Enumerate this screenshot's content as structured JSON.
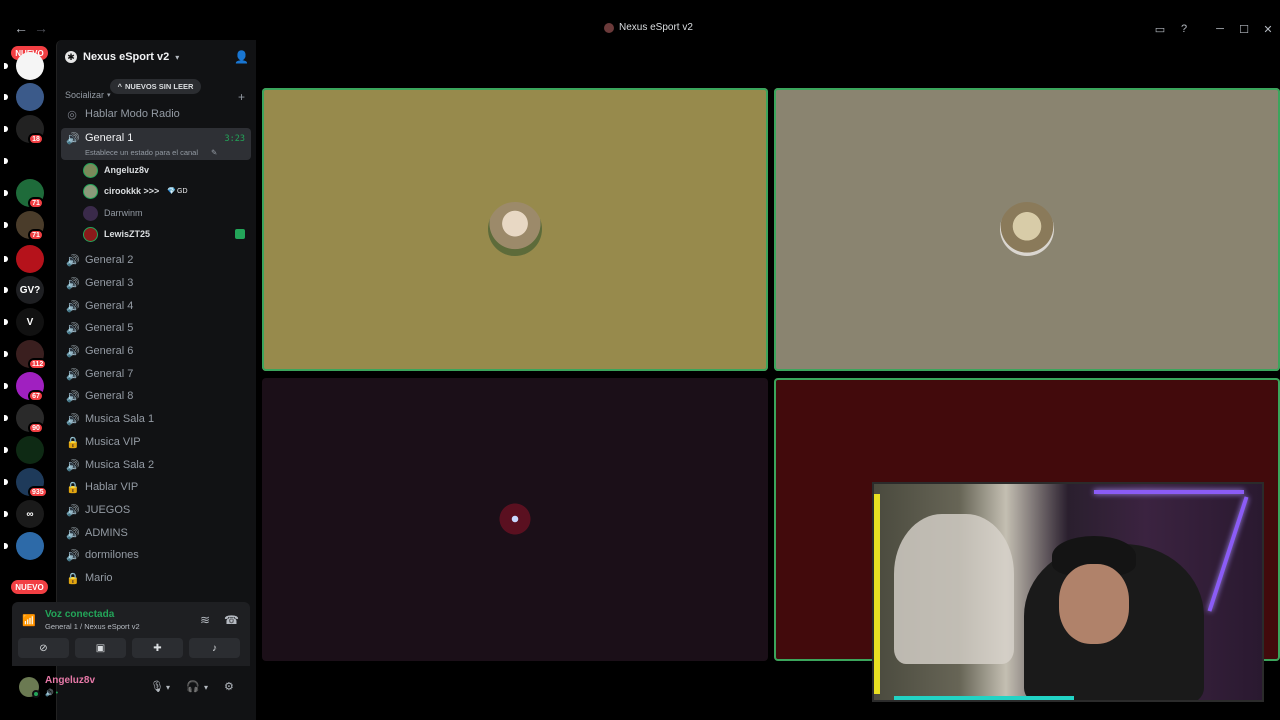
{
  "window": {
    "title": "Nexus eSport v2",
    "nav_back": "←",
    "nav_fwd": "→",
    "controls": [
      "▭",
      "?",
      "─",
      "☐",
      "✕"
    ]
  },
  "rail": {
    "nuevo_top": "NUEVO",
    "nuevo_bottom": "NUEVO",
    "servers": [
      {
        "label": "",
        "color": "#f5f5f5",
        "badge": ""
      },
      {
        "label": "",
        "color": "#3b5a8a",
        "badge": ""
      },
      {
        "label": "",
        "color": "#222222",
        "badge": "18"
      },
      {
        "label": "",
        "color": "#000000",
        "badge": ""
      },
      {
        "label": "",
        "color": "#1e6b3a",
        "badge": "71"
      },
      {
        "label": "",
        "color": "#4a3c2a",
        "badge": "71"
      },
      {
        "label": "",
        "color": "#b5121b",
        "badge": ""
      },
      {
        "label": "GV?",
        "color": "#1e1f22",
        "badge": ""
      },
      {
        "label": "V",
        "color": "#111111",
        "badge": ""
      },
      {
        "label": "",
        "color": "#3a1f1f",
        "badge": "112"
      },
      {
        "label": "",
        "color": "#a020c0",
        "badge": "67"
      },
      {
        "label": "",
        "color": "#2a2a2a",
        "badge": "90"
      },
      {
        "label": "",
        "color": "#0e2a14",
        "badge": ""
      },
      {
        "label": "",
        "color": "#1e3a5a",
        "badge": "935"
      },
      {
        "label": "∞",
        "color": "#1a1a1a",
        "badge": ""
      },
      {
        "label": "",
        "color": "#2d6aa8",
        "badge": ""
      }
    ]
  },
  "sidebar": {
    "server_name": "Nexus eSport v2",
    "unread_pill": "NUEVOS SIN LEER",
    "category": "Socializar",
    "channels": [
      {
        "name": "Hablar Modo Radio",
        "icon": "◎",
        "type": "stage"
      },
      {
        "name": "General 1",
        "icon": "🔊",
        "type": "voice",
        "active": true,
        "timer": "3:23",
        "status": "Establece un estado para el canal"
      },
      {
        "name": "General 2",
        "icon": "🔊"
      },
      {
        "name": "General 3",
        "icon": "🔊"
      },
      {
        "name": "General 4",
        "icon": "🔊"
      },
      {
        "name": "General 5",
        "icon": "🔊"
      },
      {
        "name": "General 6",
        "icon": "🔊"
      },
      {
        "name": "General 7",
        "icon": "🔊"
      },
      {
        "name": "General 8",
        "icon": "🔊"
      },
      {
        "name": "Musica Sala 1",
        "icon": "🔊"
      },
      {
        "name": "Musica VIP",
        "icon": "🔒"
      },
      {
        "name": "Musica Sala 2",
        "icon": "🔊"
      },
      {
        "name": "Hablar VIP",
        "icon": "🔒"
      },
      {
        "name": "JUEGOS",
        "icon": "🔊"
      },
      {
        "name": "ADMINS",
        "icon": "🔊"
      },
      {
        "name": "dormilones",
        "icon": "🔊"
      },
      {
        "name": "Mario",
        "icon": "🔒"
      }
    ],
    "voice_users": [
      {
        "name": "Angeluz8v",
        "avatar_color": "#7a8a5a",
        "speaking": true,
        "tag": ""
      },
      {
        "name": "cirookkk >>>",
        "avatar_color": "#8a9a7a",
        "speaking": true,
        "tag": "GD",
        "tag_icon": "💎"
      },
      {
        "name": "Darrwinm",
        "avatar_color": "#3a2a4a",
        "speaking": false,
        "tag": ""
      },
      {
        "name": "LewisZT25",
        "avatar_color": "#8a1a1a",
        "speaking": true,
        "tag": ""
      }
    ]
  },
  "voice_panel": {
    "title": "Voz conectada",
    "subtitle": "General 1 / Nexus eSport v2",
    "buttons": [
      "camera-off",
      "screen-share",
      "activities",
      "soundboard"
    ]
  },
  "user_panel": {
    "username": "Angeluz8v",
    "status": "•",
    "status_icon": "🔊"
  },
  "stage": {
    "tiles": [
      {
        "user": "Angeluz8v",
        "bg": "#978a4c",
        "speaking": true
      },
      {
        "user": "cirookkk >>>",
        "bg": "#8a8470",
        "speaking": true
      },
      {
        "user": "Darrwinm",
        "bg": "#1b0f18",
        "speaking": false
      },
      {
        "user": "LewisZT25",
        "bg": "#420a0c",
        "speaking": true
      }
    ]
  },
  "colors": {
    "accent_green": "#23a559",
    "badge_red": "#f23f43"
  }
}
